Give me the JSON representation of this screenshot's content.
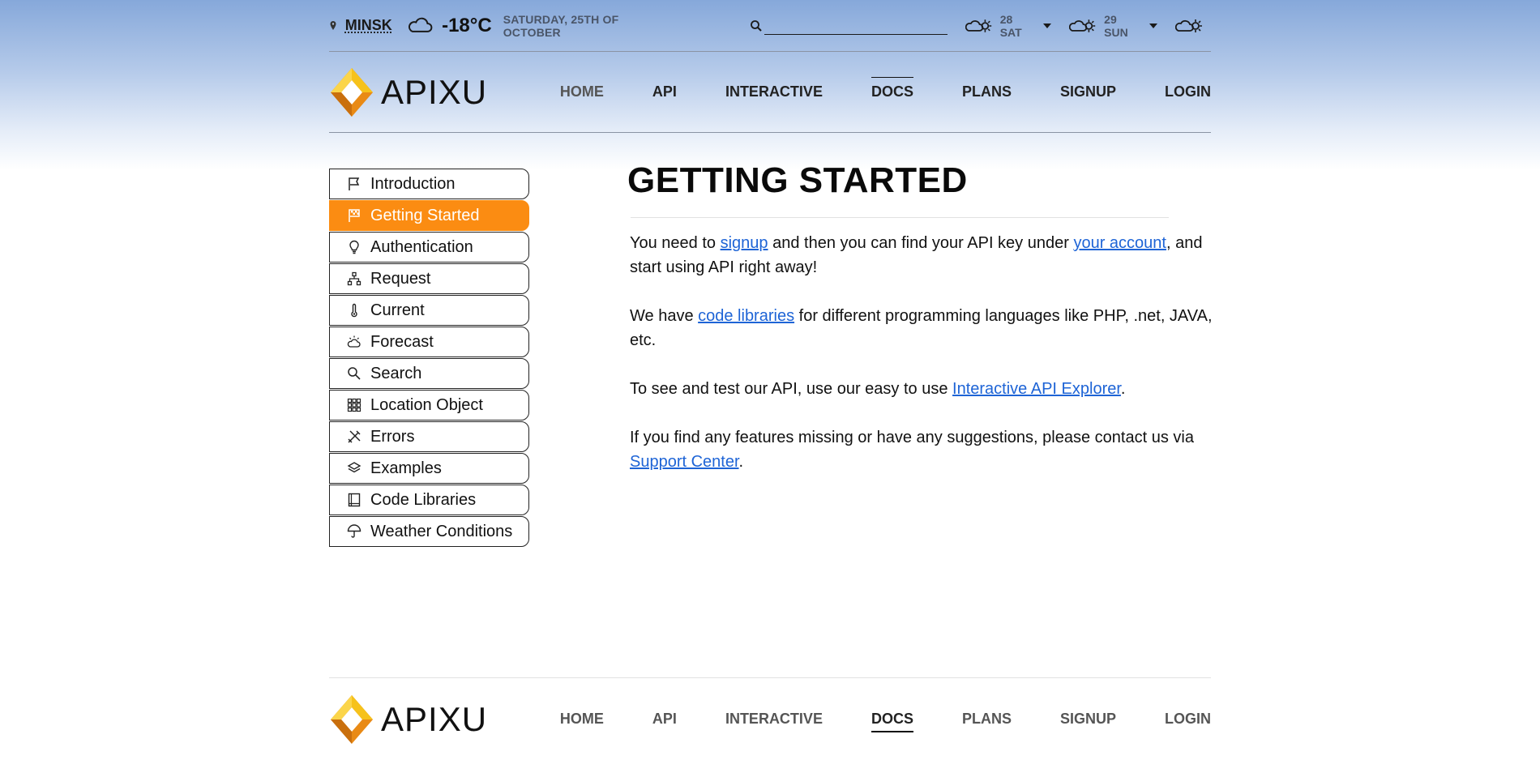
{
  "topbar": {
    "city": "MINSK",
    "temperature": "-18°C",
    "date": "SATURDAY, 25TH OF OCTOBER",
    "search_placeholder": "",
    "forecast": [
      {
        "label": "28 SAT",
        "icon": "partly-cloudy-icon"
      },
      {
        "label": "29 SUN",
        "icon": "partly-cloudy-icon"
      },
      {
        "label": "",
        "icon": "partly-cloudy-icon"
      }
    ]
  },
  "brand": {
    "name": "APIXU"
  },
  "nav": {
    "items": [
      "HOME",
      "API",
      "INTERACTIVE",
      "DOCS",
      "PLANS",
      "SIGNUP",
      "LOGIN"
    ],
    "active": "DOCS"
  },
  "sidebar": {
    "items": [
      {
        "label": "Introduction",
        "icon": "flag-icon"
      },
      {
        "label": "Getting Started",
        "icon": "checkered-flag-icon",
        "active": true
      },
      {
        "label": "Authentication",
        "icon": "lightbulb-icon"
      },
      {
        "label": "Request",
        "icon": "sitemap-icon"
      },
      {
        "label": "Current",
        "icon": "thermometer-icon"
      },
      {
        "label": "Forecast",
        "icon": "sun-cloud-icon"
      },
      {
        "label": "Search",
        "icon": "search-icon"
      },
      {
        "label": "Location Object",
        "icon": "grid-icon"
      },
      {
        "label": "Errors",
        "icon": "tools-icon"
      },
      {
        "label": "Examples",
        "icon": "layers-icon"
      },
      {
        "label": "Code Libraries",
        "icon": "book-icon"
      },
      {
        "label": "Weather Conditions",
        "icon": "umbrella-icon"
      }
    ]
  },
  "content": {
    "title": "GETTING STARTED",
    "p1": {
      "t1": "You need to ",
      "link1": "signup",
      "t2": " and then you can find your API key under ",
      "link2": "your account",
      "t3": ", and start using API right away!"
    },
    "p2": {
      "t1": "We have ",
      "link1": "code libraries",
      "t2": " for different programming languages like PHP, .net, JAVA, etc."
    },
    "p3": {
      "t1": "To see and test our API, use our easy to use ",
      "link1": "Interactive API Explorer",
      "t2": "."
    },
    "p4": {
      "t1": "If you find any features missing or have any suggestions, please contact us via ",
      "link1": "Support Center",
      "t2": "."
    }
  },
  "colors": {
    "accent": "#fb8c12",
    "link": "#1e64d6",
    "logo_yellow": "#f6c21b",
    "logo_orange": "#e98a15"
  }
}
